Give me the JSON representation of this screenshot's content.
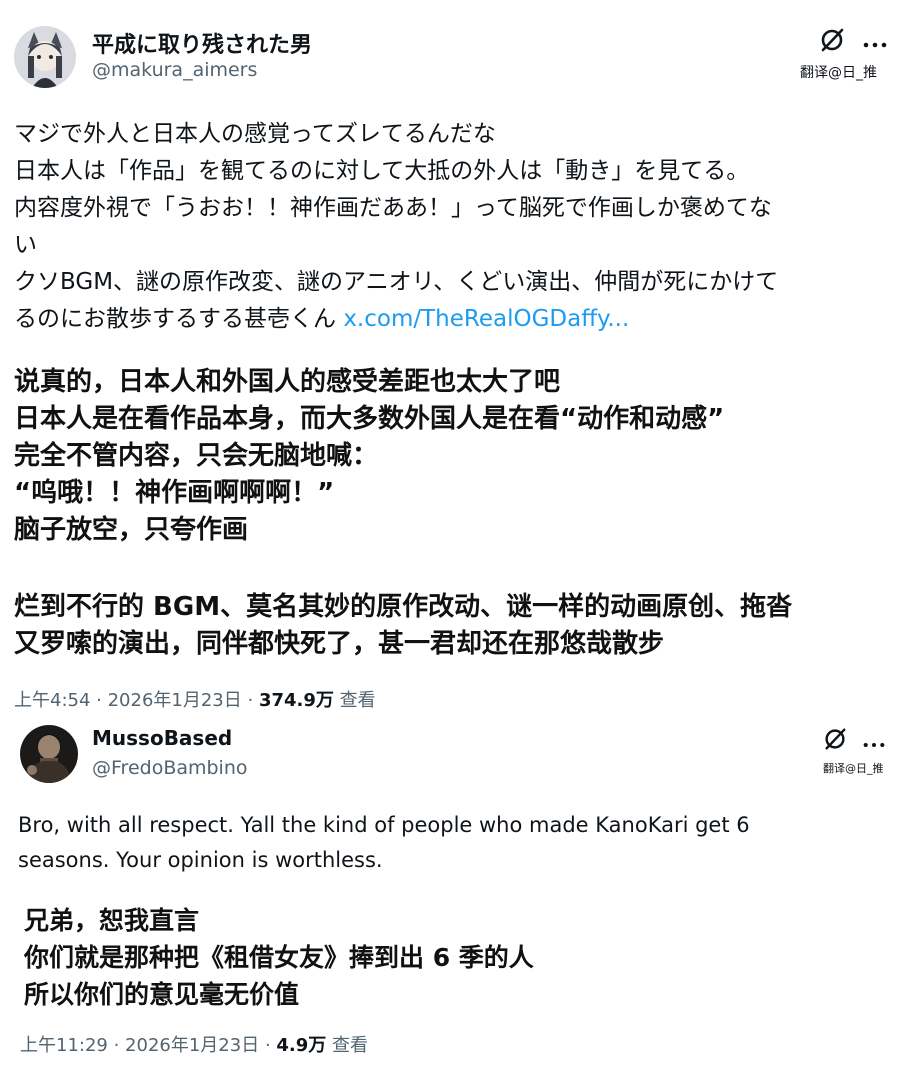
{
  "post1": {
    "display_name": "平成に取り残された男",
    "handle": "@makura_aimers",
    "translate_label": "翻译@日_推",
    "more_icon": "more-dots-icon",
    "grok_icon": "slashed-circle-icon",
    "text_lines": [
      "マジで外人と日本人の感覚ってズレてるんだな",
      "日本人は「作品」を観てるのに対して大抵の外人は「動き」を見てる。",
      "内容度外視で「うおお！！神作画だああ！」って脳死で作画しか褒めてな",
      "い",
      "クソBGM、謎の原作改変、謎のアニオリ、くどい演出、仲間が死にかけて"
    ],
    "last_line_text": "るのにお散歩するする甚壱くん",
    "link_text": "x.com/TheRealOGDaffy...",
    "translation_lines": [
      "说真的，日本人和外国人的感受差距也太大了吧",
      "日本人是在看作品本身，而大多数外国人是在看“动作和动感”",
      "完全不管内容，只会无脑地喊：",
      "“呜哦！！神作画啊啊啊！”",
      "脑子放空，只夸作画",
      "烂到不行的 BGM、莫名其妙的原作改动、谜一样的动画原创、拖沓",
      "又罗嗦的演出，同伴都快死了，甚一君却还在那悠哉散步"
    ],
    "time": "上午4:54",
    "date": "2026年1月23日",
    "views": "374.9万",
    "views_label": "查看",
    "separator": " · "
  },
  "post2": {
    "display_name": "MussoBased",
    "handle": "@FredoBambino",
    "translate_label": "翻译@日_推",
    "more_icon": "more-dots-icon",
    "grok_icon": "slashed-circle-icon",
    "text_lines": [
      "Bro, with all respect. Yall the kind of people who made KanoKari get 6",
      "seasons. Your opinion is worthless."
    ],
    "translation_lines": [
      "兄弟，恕我直言",
      "你们就是那种把《租借女友》捧到出 6 季的人",
      "所以你们的意见毫无价值"
    ],
    "time": "上午11:29",
    "date": "2026年1月23日",
    "views": "4.9万",
    "views_label": "查看",
    "separator": " · "
  }
}
